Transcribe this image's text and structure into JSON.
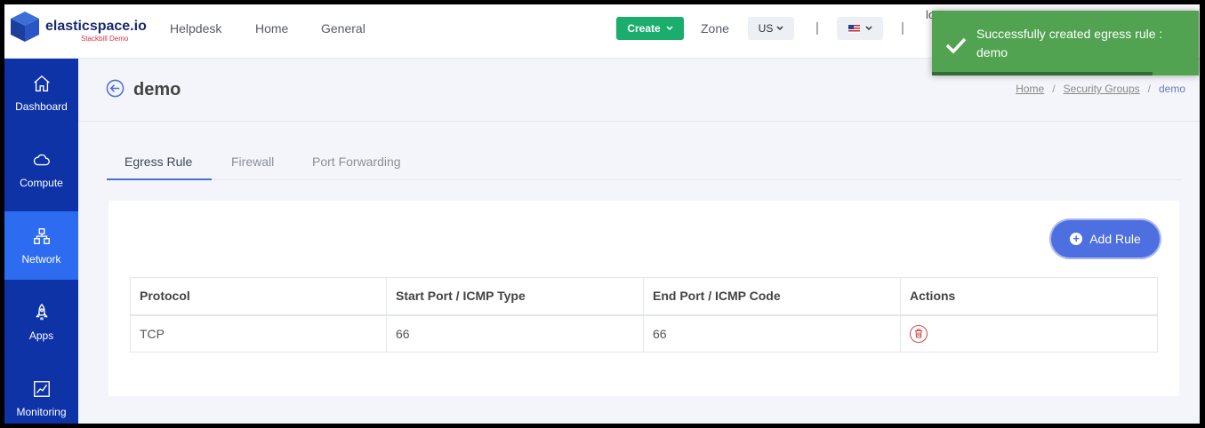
{
  "brand": {
    "name": "elasticspace.io",
    "subtitle": "Stackbill Demo"
  },
  "nav": {
    "items": [
      "Helpdesk",
      "Home",
      "General"
    ]
  },
  "header": {
    "create_label": "Create",
    "zone_label": "Zone",
    "zone_value": "US",
    "separator": "|",
    "user_text": "lo"
  },
  "sidebar": {
    "items": [
      {
        "label": "Dashboard",
        "icon": "home-icon"
      },
      {
        "label": "Compute",
        "icon": "cloud-icon"
      },
      {
        "label": "Network",
        "icon": "network-icon",
        "active": true
      },
      {
        "label": "Apps",
        "icon": "rocket-icon"
      },
      {
        "label": "Monitoring",
        "icon": "chart-icon"
      }
    ]
  },
  "page": {
    "title": "demo"
  },
  "breadcrumb": {
    "items": [
      "Home",
      "Security Groups"
    ],
    "current": "demo",
    "separator": "/"
  },
  "tabs": [
    "Egress Rule",
    "Firewall",
    "Port Forwarding"
  ],
  "add_rule_label": "Add Rule",
  "table": {
    "headers": [
      "Protocol",
      "Start Port / ICMP Type",
      "End Port / ICMP Code",
      "Actions"
    ],
    "rows": [
      {
        "protocol": "TCP",
        "start": "66",
        "end": "66"
      }
    ]
  },
  "toast": {
    "message": "Successfully created egress rule : demo",
    "color": "#51a351"
  },
  "colors": {
    "sidebar": "#0d33a6",
    "sidebar_active": "#2d6cf0",
    "create": "#1aad6c",
    "primary": "#4e6fe0"
  }
}
